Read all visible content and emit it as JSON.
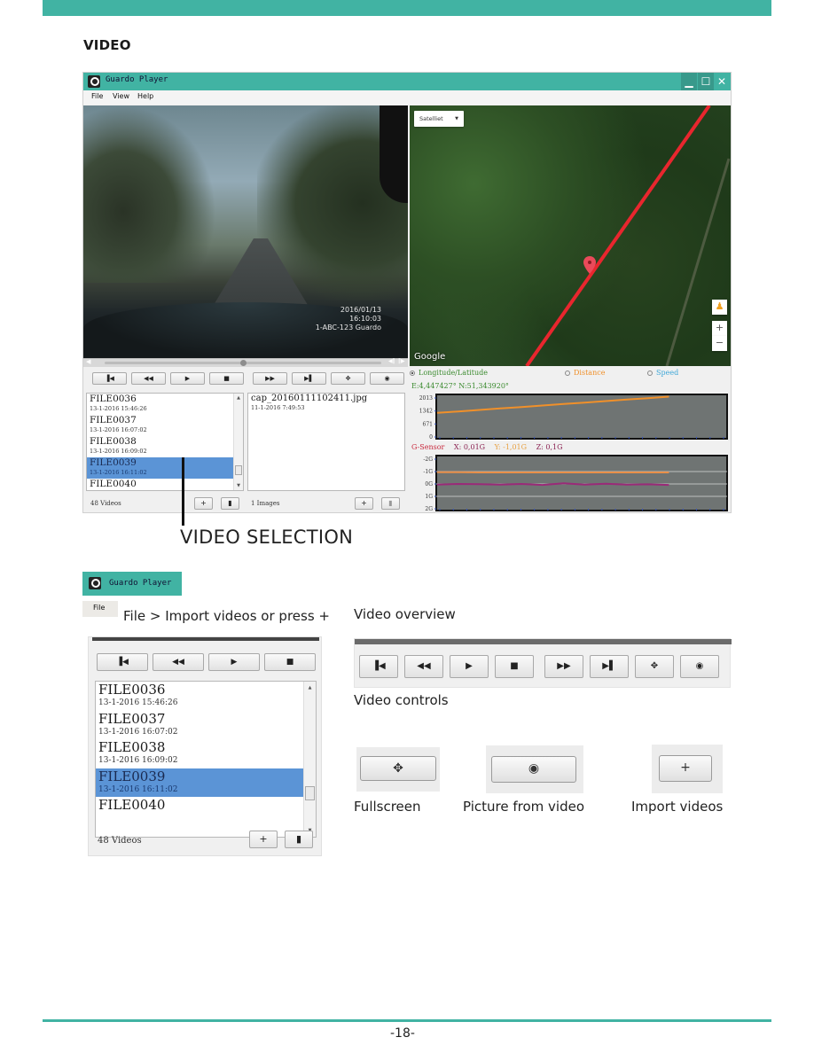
{
  "page": {
    "section_title": "VIDEO",
    "page_number": "-18-",
    "accent_color": "#41b3a3"
  },
  "app": {
    "title": "Guardo Player",
    "window_controls": [
      "minimize",
      "maximize",
      "close"
    ],
    "menu": [
      "File",
      "View",
      "Help"
    ],
    "video_overlay": {
      "date": "2016/01/13",
      "time": "16:10:03",
      "plate": "1-ABC-123 Guardo"
    },
    "seek_position": 0.5,
    "controls": [
      {
        "name": "previous",
        "glyph": "⏮"
      },
      {
        "name": "rewind",
        "glyph": "◀◀"
      },
      {
        "name": "play",
        "glyph": "▶"
      },
      {
        "name": "stop",
        "glyph": "■"
      },
      {
        "name": "fast-forward",
        "glyph": "▶▶"
      },
      {
        "name": "next",
        "glyph": "⏭"
      },
      {
        "name": "fullscreen",
        "glyph": "✥"
      },
      {
        "name": "snapshot",
        "glyph": "📷"
      }
    ],
    "videos": [
      {
        "name": "FILE0036",
        "date": "13-1-2016 15:46:26",
        "selected": false
      },
      {
        "name": "FILE0037",
        "date": "13-1-2016 16:07:02",
        "selected": false
      },
      {
        "name": "FILE0038",
        "date": "13-1-2016 16:09:02",
        "selected": true
      },
      {
        "name": "FILE0039",
        "date": "13-1-2016 16:11:02",
        "selected": true
      },
      {
        "name": "FILE0040",
        "date": "",
        "selected": false
      }
    ],
    "videos_count": "48 Videos",
    "images": [
      {
        "name": "cap_20160111102411.jpg",
        "date": "11-1-2016 7:49:53"
      }
    ],
    "images_count": "1 Images",
    "add_label": "+",
    "delete_label": "🗑",
    "map": {
      "type_select": "Satelliet",
      "attribution": "Google",
      "zoom_in": "+",
      "zoom_out": "−",
      "pegman": "🚶"
    },
    "modes": {
      "lonlat": "Longitude/Latitude",
      "distance": "Distance",
      "speed": "Speed",
      "selected": "lonlat"
    },
    "coords": "E:4,447427°  N:51,343920°",
    "gsensor": {
      "label": "G-Sensor",
      "x": "X: 0,01G",
      "y": "Y: -1,01G",
      "z": "Z: 0,1G"
    }
  },
  "chart_data": [
    {
      "type": "line",
      "title": "Distance",
      "yticks": [
        "2013",
        "1342",
        "671",
        "0"
      ],
      "ylim": [
        0,
        2400
      ],
      "series": [
        {
          "name": "distance",
          "color": "#f0902a",
          "values": [
            1400,
            1480,
            1560,
            1640,
            1720,
            1800,
            1880,
            1960,
            2040,
            2120,
            2200,
            2280
          ]
        }
      ]
    },
    {
      "type": "line",
      "title": "G-Sensor",
      "yticks": [
        "-2G",
        "-1G",
        "0G",
        "1G",
        "2G"
      ],
      "ylim": [
        -2,
        2
      ],
      "series": [
        {
          "name": "Y",
          "color": "#e8904a",
          "values": [
            -0.95,
            -0.95,
            -0.93,
            -0.93,
            -0.93,
            -0.93,
            -0.93,
            -0.93,
            -0.93,
            -0.93,
            -0.93,
            -0.93
          ]
        },
        {
          "name": "X",
          "color": "#9a2a78",
          "values": [
            0.05,
            0.0,
            0.02,
            0.05,
            0.0,
            0.08,
            -0.05,
            0.05,
            -0.02,
            0.05,
            0.03,
            0.08
          ]
        }
      ]
    }
  ],
  "annotations": {
    "video_selection": "VIDEO SELECTION",
    "import_hint": "File > Import videos or press +",
    "file_menu": "File",
    "video_overview": "Video overview",
    "video_controls": "Video controls",
    "fullscreen": "Fullscreen",
    "picture_from_video": "Picture from video",
    "import_videos": "Import videos"
  }
}
